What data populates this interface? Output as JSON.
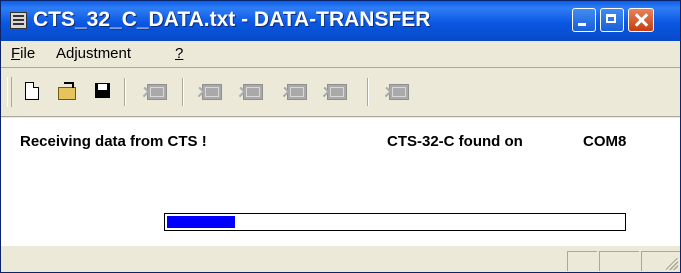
{
  "window": {
    "title": "CTS_32_C_DATA.txt - DATA-TRANSFER"
  },
  "menu": {
    "file": "ile",
    "file_mnemonic": "F",
    "adjustment": "Adjustment",
    "help": "?"
  },
  "toolbar": {
    "icons": [
      "new-document-icon",
      "open-folder-icon",
      "save-disk-icon",
      "send-data-icon",
      "receive-data-icon",
      "waveform-icon",
      "cursor-icon",
      "ai-icon",
      "last-icon"
    ]
  },
  "content": {
    "status_message": "Receiving data from CTS !",
    "device_found": "CTS-32-C found on",
    "port": "COM8",
    "progress": 0.15
  },
  "colors": {
    "titlebar": "#0a57e2",
    "progress_fill": "#0000ff",
    "close_button": "#c63d10"
  }
}
